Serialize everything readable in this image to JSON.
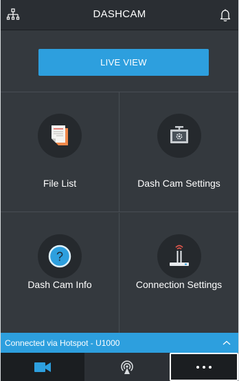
{
  "header": {
    "title": "DASHCAM",
    "left_icon": "network-icon",
    "right_icon": "bell-icon"
  },
  "live_view": {
    "label": "LIVE VIEW"
  },
  "tiles": [
    {
      "label": "File List",
      "icon": "file-list-icon"
    },
    {
      "label": "Dash Cam Settings",
      "icon": "dashcam-settings-icon"
    },
    {
      "label": "Dash Cam Info",
      "icon": "question-icon"
    },
    {
      "label": "Connection Settings",
      "icon": "router-icon"
    }
  ],
  "status_bar": {
    "text": "Connected via Hotspot - U1000",
    "icon": "chevron-up-icon"
  },
  "tabbar": {
    "tabs": [
      {
        "icon": "video-camera-icon",
        "selected": false
      },
      {
        "icon": "wireless-icon",
        "selected": false
      },
      {
        "icon": "more-icon",
        "selected": true
      }
    ]
  },
  "colors": {
    "accent": "#2d9fde",
    "background": "#34393e",
    "header": "#2a2e33",
    "icon_circle": "#25292d"
  }
}
